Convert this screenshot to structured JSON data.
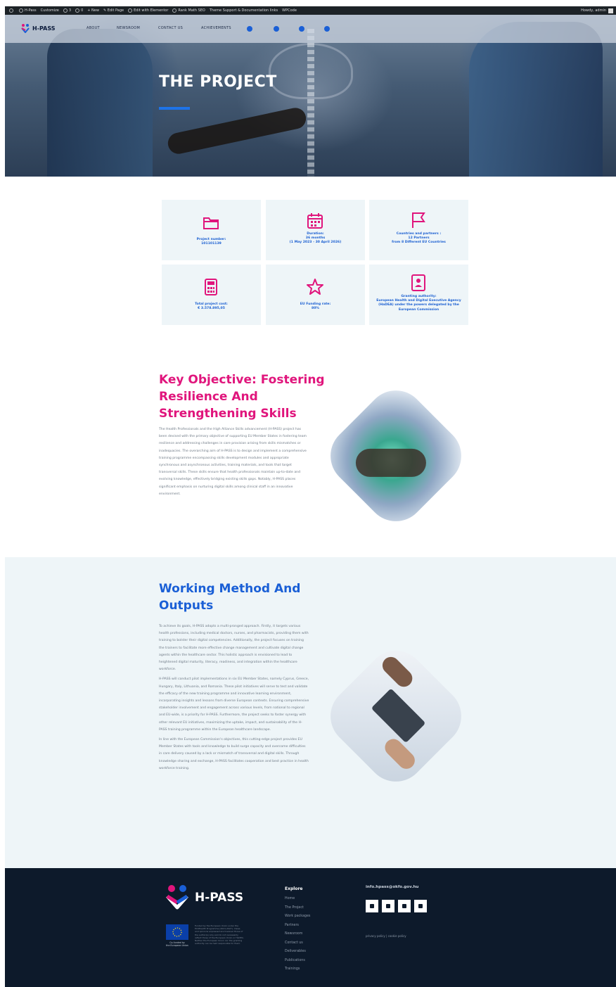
{
  "admin_bar": {
    "items": [
      "H-Pass",
      "Customize",
      "3",
      "0",
      "New",
      "Edit Page",
      "Edit with Elementor",
      "Rank Math SEO",
      "Theme Support & Documentation links",
      "WPCode"
    ],
    "howdy": "Howdy, admin"
  },
  "nav": {
    "logo_text": "H-PASS",
    "links": [
      "ABOUT",
      "NEWSROOM",
      "CONTACT US",
      "ACHIEVEMENTS"
    ],
    "social_icons": [
      "email-icon",
      "youtube-icon",
      "linkedin-icon",
      "twitter-icon"
    ],
    "accent": "#1a5fd6"
  },
  "hero": {
    "title": "THE PROJECT",
    "underline_color": "#1e73e8"
  },
  "stats": [
    {
      "icon": "folder-icon",
      "label": "Project number:",
      "value": "101101139"
    },
    {
      "icon": "calendar-icon",
      "label": "Duration:",
      "value": "36 months",
      "extra": "(1 May 2023 - 30 April 2026)"
    },
    {
      "icon": "flag-icon",
      "label": "Countries and partners :",
      "value": "12 Partners",
      "extra": "from 8 Different EU Countries"
    },
    {
      "icon": "calculator-icon",
      "label": "Total project cost:",
      "value": "€ 3.578.895,05"
    },
    {
      "icon": "star-icon",
      "label": "EU Funding rate:",
      "value": "80%"
    },
    {
      "icon": "id-card-icon",
      "label": "Granting authority:",
      "value": "European Health and Digital Executive Agency",
      "extra": "(HaDEA) under the powers delegated by the",
      "extra2": "European Commission"
    }
  ],
  "key_objective": {
    "heading_line1": "Key Objective: Fostering",
    "heading_line2": "Resilience And",
    "heading_line3": "Strengthening Skills",
    "paragraph": "The Health Professionals and the High Alliance Skills advancement (H-PASS) project has been devised with the primary objective of supporting EU Member States in fostering team resilience and addressing challenges in care provision arising from skills mismatches or inadequacies. The overarching aim of H-PASS is to design and implement a comprehensive training programme encompassing skills development modules and appropriate synchronous and asynchronous activities, training materials, and tools that target transversal skills. These skills ensure that health professionals maintain up-to-date and evolving knowledge, effectively bridging existing skills gaps. Notably, H-PASS places significant emphasis on nurturing digital skills among clinical staff in an innovative environment."
  },
  "working_method": {
    "heading_line1": "Working Method And",
    "heading_line2": "Outputs",
    "paragraphs": [
      "To achieve its goals, H-PASS adopts a multi-pronged approach. Firstly, it targets various health professions, including medical doctors, nurses, and pharmacists, providing them with training to bolster their digital competencies. Additionally, the project focuses on training the trainers to facilitate more effective change management and cultivate digital change agents within the healthcare sector. This holistic approach is envisioned to lead to heightened digital maturity, literacy, readiness, and integration within the healthcare workforce.",
      "H-PASS will conduct pilot implementations in six EU Member States, namely Cyprus, Greece, Hungary, Italy, Lithuania, and Romania. These pilot initiatives will serve to test and validate the efficacy of the new training programme and innovative learning environment, incorporating insights and lessons from diverse European contexts. Ensuring comprehensive stakeholder involvement and engagement across various levels, from national to regional and EU-wide, is a priority for H-PASS. Furthermore, the project seeks to foster synergy with other relevant EU initiatives, maximizing the uptake, impact, and sustainability of the H-PASS training programme within the European healthcare landscape.",
      "In line with the European Commission's objectives, this cutting-edge project provides EU Member States with tools and knowledge to build surge capacity and overcome difficulties in care delivery caused by a lack or mismatch of transversal and digital skills. Through knowledge sharing and exchange, H-PASS facilitates cooperation and best practice in health workforce training."
    ]
  },
  "footer": {
    "logo_text": "H-PASS",
    "eu_caption_line1": "Co-funded by",
    "eu_caption_line2": "the European Union",
    "disclaimer": "Funded by the European Union under the EU4Health Programme (2021-2027). Views and opinions expressed are however those of the author(s) only and do not necessarily reflect those of the European Union or HaDEA. Neither the European Union nor the granting authority can be held responsible for them.",
    "explore_title": "Explore",
    "explore_links": [
      "Home",
      "The Project",
      "Work packages",
      "Partners",
      "Newsroom",
      "Contact us",
      "Deliverables",
      "Publications",
      "Trainings"
    ],
    "email": "info.hpass@okfo.gov.hu",
    "footer_socials": [
      "email-icon",
      "youtube-icon",
      "linkedin-icon",
      "twitter-icon"
    ],
    "credits": "privacy policy | cookie policy",
    "bg_color": "#0d1a2b"
  },
  "colors": {
    "pink": "#e0157c",
    "blue": "#1a5fd6",
    "card_bg": "#eef5f8"
  }
}
